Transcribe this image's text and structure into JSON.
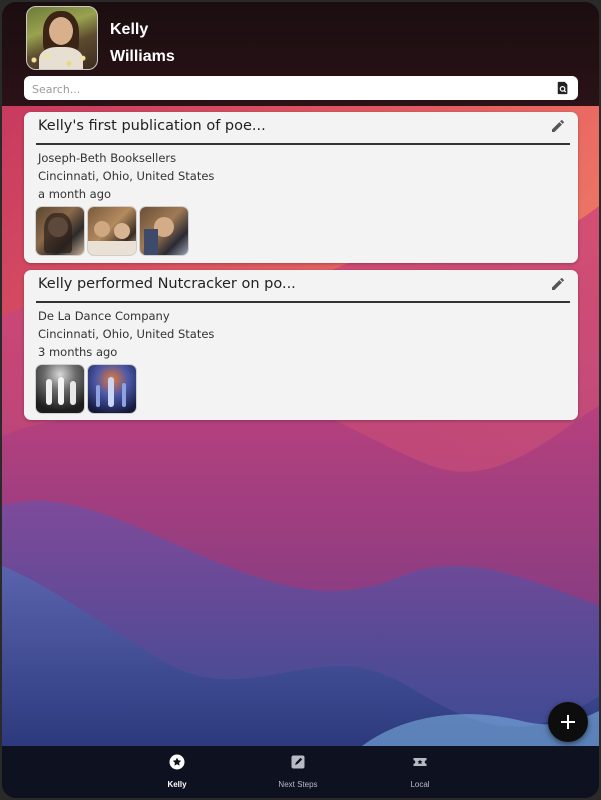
{
  "profile": {
    "first_name": "Kelly",
    "last_name": "Williams"
  },
  "search": {
    "placeholder": "Search...",
    "value": ""
  },
  "posts": [
    {
      "title": "Kelly's first publication of poe...",
      "venue": "Joseph-Beth Booksellers",
      "location": "Cincinnati, Ohio, United States",
      "time": "a month ago",
      "photo_count": 3
    },
    {
      "title": "Kelly performed Nutcracker on po...",
      "venue": "De La Dance Company",
      "location": "Cincinnati, Ohio, United States",
      "time": "3 months ago",
      "photo_count": 2
    }
  ],
  "nav": {
    "items": [
      {
        "label": "Kelly",
        "icon": "star-icon",
        "active": true
      },
      {
        "label": "Next Steps",
        "icon": "edit-note-icon",
        "active": false
      },
      {
        "label": "Local",
        "icon": "ticket-icon",
        "active": false
      }
    ]
  },
  "fab": {
    "icon": "plus-icon"
  },
  "colors": {
    "header_bg": "#1b0e10",
    "card_bg": "#f3f3f3",
    "nav_bg": "#0e1220",
    "fab_bg": "#0d0d0d"
  }
}
